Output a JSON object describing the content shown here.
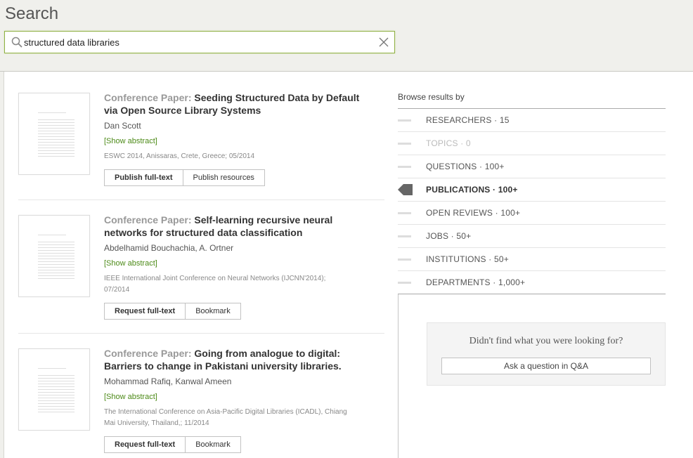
{
  "header": {
    "title": "Search",
    "search_value": "structured data libraries"
  },
  "colors": {
    "accent_green": "#8fb043",
    "abstract_link": "#4c8a17"
  },
  "results": [
    {
      "type": "Conference Paper:",
      "title": "Seeding Structured Data by Default via Open Source Library Systems",
      "authors": "Dan Scott",
      "abstract_link": "[Show abstract]",
      "venue": "ESWC 2014, Anissaras, Crete, Greece; 05/2014",
      "buttons": [
        "Publish full-text",
        "Publish resources"
      ]
    },
    {
      "type": "Conference Paper:",
      "title": "Self-learning recursive neural networks for structured data classification",
      "authors": "Abdelhamid Bouchachia, A. Ortner",
      "abstract_link": "[Show abstract]",
      "venue": "IEEE International Joint Conference on Neural Networks (IJCNN'2014); 07/2014",
      "buttons": [
        "Request full-text",
        "Bookmark"
      ]
    },
    {
      "type": "Conference Paper:",
      "title": "Going from analogue to digital: Barriers to change in Pakistani university libraries.",
      "authors": "Mohammad Rafiq, Kanwal Ameen",
      "abstract_link": "[Show abstract]",
      "venue": "The International Conference on Asia-Pacific Digital Libraries (ICADL), Chiang Mai University, Thailand,; 11/2014",
      "buttons": [
        "Request full-text",
        "Bookmark"
      ]
    }
  ],
  "browse": {
    "title": "Browse results by",
    "items": [
      {
        "label": "RESEARCHERS · 15",
        "state": "normal"
      },
      {
        "label": "TOPICS · 0",
        "state": "disabled"
      },
      {
        "label": "QUESTIONS · 100+",
        "state": "normal"
      },
      {
        "label": "PUBLICATIONS · 100+",
        "state": "active"
      },
      {
        "label": "OPEN REVIEWS · 100+",
        "state": "normal"
      },
      {
        "label": "JOBS · 50+",
        "state": "normal"
      },
      {
        "label": "INSTITUTIONS · 50+",
        "state": "normal"
      },
      {
        "label": "DEPARTMENTS · 1,000+",
        "state": "normal"
      }
    ]
  },
  "qa": {
    "message": "Didn't find what you were looking for?",
    "button": "Ask a question in Q&A"
  }
}
